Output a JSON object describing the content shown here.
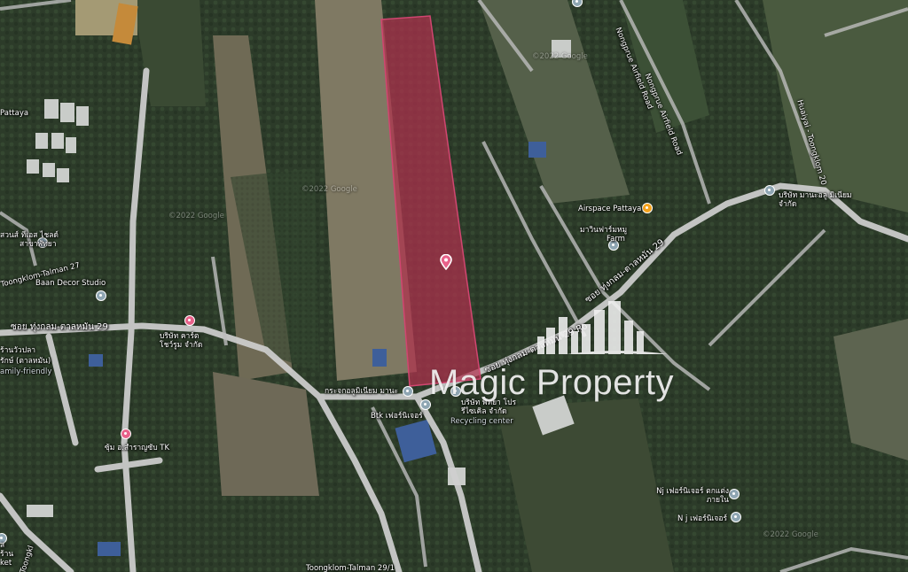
{
  "colors": {
    "parcel_fill": "#b0304e",
    "road": "#d9d9d9",
    "field_light": "#8e8a6e",
    "vegetation": "#2f3f2c",
    "pin_grey": "#8fa6b3",
    "pin_pink": "#e8628a",
    "pin_orange": "#f4a21b"
  },
  "watermark": {
    "text": "Magic Property"
  },
  "roads": {
    "soi_29_left": "ซอย ทุ่งกลม-ตาลหมัน 29",
    "soi_29_center": "ซอย ทุ่งกลม-ตาลหมัน 29 Ro",
    "soi_29_right": "ซอย ทุ่งกลม-ตาลหมัน 29",
    "nongprue_airfield_1": "Nongprue Airfield Road",
    "nongprue_airfield_2": "Nongprue Airfield Road",
    "huaiyai_toongklom": "Huaiyai - Toongklom 20",
    "toongklom_tal_29_1": "Toongklom-Talman 29/1",
    "toongklom_tal_left": "Toongklom-Talman 27",
    "toongkl_bottom": "Toongkl"
  },
  "places": {
    "airspace": "Airspace Pattaya",
    "manee_aluminium": "บริษัท มานะอลู มิเนียม จำกัด",
    "farm_th": "มาวินฟาร์มหมู",
    "farm_en": "Farm",
    "baan_decor": "Baan Decor Studio",
    "cart_company": "บริษัท คาร์ต โชว์รูม จำกัด",
    "mirror_aluminium": "กระจกอลูมิเนียม มานะ",
    "btk_furniture": "Btk เฟอร์นิเจอร์",
    "pattaya_recycling": "บริษัท พัทยา โปร รีไซเคิล จำกัด",
    "recycling_center": "Recycling center",
    "sum_pub": "ซุ้ม อ.สำราญซับ TK",
    "nj_furniture_1": "Nj เฟอร์นิเจอร์ ตกแต่งภายใน",
    "nj_furniture_2": "N j เฟอร์นิเจอร์",
    "pattaya_left": "Pattaya",
    "suan_thai": "สวนส์ ทีเอส ไชลด์",
    "noodle": "สาขาพัทยา",
    "plaza_left": "ร้านวัวปลา",
    "plaza_left2": "รักษ์ (ตาลหมัน)",
    "family": "amily-friendly",
    "left_edge_1": "ส",
    "left_edge_2": "ร้าน",
    "left_edge_3": "ket"
  },
  "watermarks_google": {
    "g1": "©2022 Google",
    "g2": "©2022 Google",
    "g3": "©2022 Google",
    "g4": "©2022 Google"
  }
}
